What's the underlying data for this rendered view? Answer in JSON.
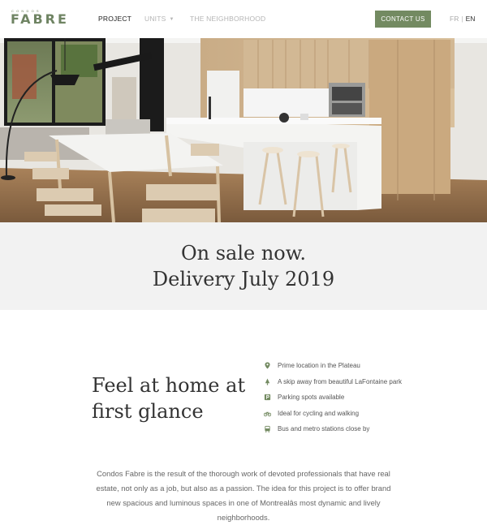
{
  "brand": {
    "small": "CONDOS",
    "name": "FABRE"
  },
  "nav": {
    "project": "PROJECT",
    "units": "UNITS",
    "neighborhood": "THE NEIGHBORHOOD"
  },
  "contact_label": "CONTACT US",
  "lang": {
    "fr": "FR",
    "sep": "|",
    "en": "EN"
  },
  "carousel": {
    "slide_count": 4,
    "active_index": 3
  },
  "sale": {
    "line1": "On sale now.",
    "line2": "Delivery July 2019"
  },
  "intro": {
    "title_line1": "Feel at home at",
    "title_line2": "first glance",
    "features": [
      {
        "icon": "map-pin-icon",
        "text": "Prime location in the Plateau"
      },
      {
        "icon": "tree-icon",
        "text": "A skip away from beautiful LaFontaine park"
      },
      {
        "icon": "parking-icon",
        "text": "Parking spots available"
      },
      {
        "icon": "bicycle-icon",
        "text": "Ideal for cycling and walking"
      },
      {
        "icon": "bus-icon",
        "text": "Bus and metro stations close by"
      }
    ],
    "paragraph": "Condos Fabre is the result of the thorough work of devoted professionals that have real estate, not only as a job, but also as a passion. The idea for this project is to offer brand new spacious and luminous spaces in one of Montrealâs most dynamic and lively neighborhoods."
  },
  "colors": {
    "accent": "#738a61",
    "band": "#f2f2f2"
  }
}
